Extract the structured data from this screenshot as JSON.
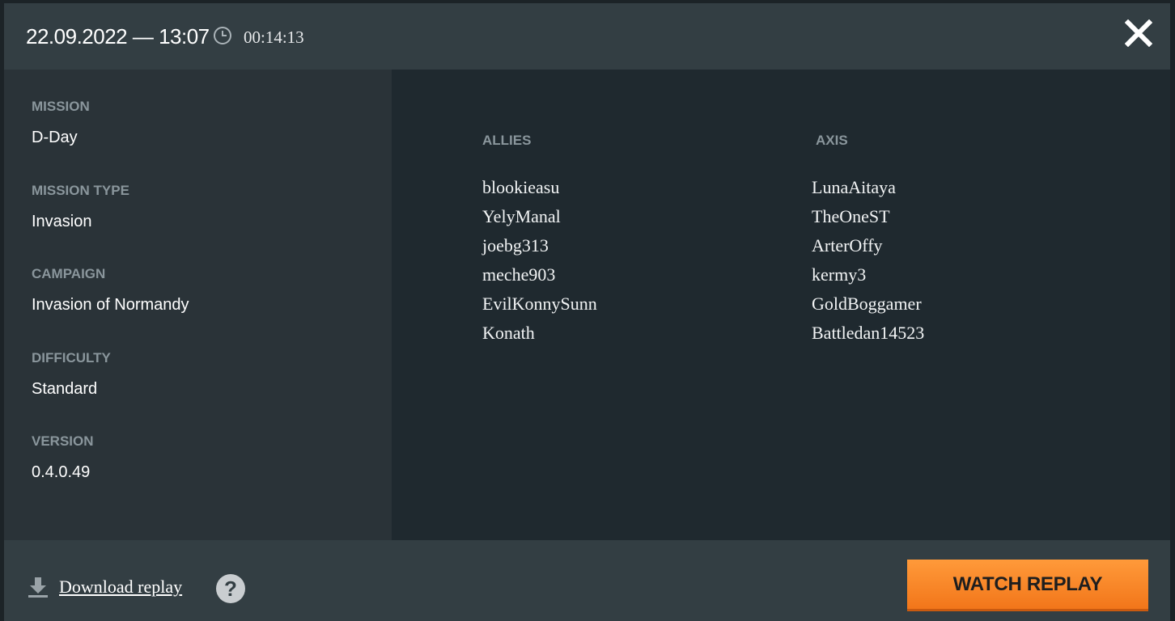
{
  "header": {
    "date": "22.09.2022 — 13:07",
    "duration": "00:14:13",
    "clock_icon": "clock-icon",
    "close_icon": "close-icon"
  },
  "details": [
    {
      "label": "MISSION",
      "value": "D-Day"
    },
    {
      "label": "MISSION TYPE",
      "value": "Invasion"
    },
    {
      "label": "CAMPAIGN",
      "value": "Invasion of Normandy"
    },
    {
      "label": "DIFFICULTY",
      "value": "Standard"
    },
    {
      "label": "VERSION",
      "value": "0.4.0.49"
    }
  ],
  "teams": {
    "allies": {
      "title": "ALLIES",
      "players": [
        "blookieasu",
        "YelyManal",
        "joebg313",
        "meche903",
        "EvilKonnySunn",
        "Konath"
      ]
    },
    "axis": {
      "title": "AXIS",
      "players": [
        "LunaAitaya",
        "TheOneST",
        "ArterOffy",
        "kermy3",
        "GoldBoggamer",
        "Battledan14523"
      ]
    }
  },
  "footer": {
    "download_label": "Download replay",
    "help_label": "?",
    "watch_label": "WATCH REPLAY"
  },
  "colors": {
    "accent": "#f7821f",
    "header_bg": "#333e43",
    "panel_bg": "#2a3338",
    "players_bg": "#1f292f"
  }
}
